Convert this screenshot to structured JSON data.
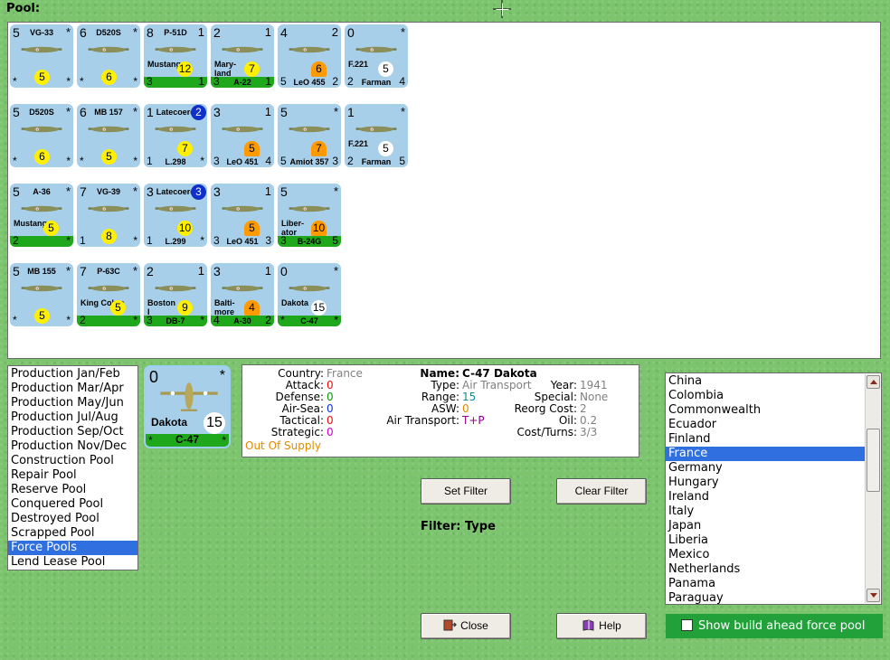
{
  "pool_label": "Pool:",
  "counters": [
    {
      "tl": "5",
      "tr": "*",
      "name": "VG-33",
      "sub": "",
      "bl": "*",
      "br": "*",
      "bname": "",
      "badge": "5",
      "badge_color": "yellow",
      "green": false
    },
    {
      "tl": "6",
      "tr": "*",
      "name": "D520S",
      "sub": "",
      "bl": "*",
      "br": "*",
      "bname": "",
      "badge": "6",
      "badge_color": "yellow",
      "green": false
    },
    {
      "tl": "8",
      "tr": "1",
      "name": "P-51D",
      "sub": "Mustang",
      "bl": "3",
      "br": "1",
      "bname": "",
      "badge": "12",
      "badge_color": "yellow",
      "green": true
    },
    {
      "tl": "2",
      "tr": "1",
      "name": "",
      "sub": "Mary-\nland",
      "bl": "3",
      "br": "1",
      "bname": "A-22",
      "badge": "7",
      "badge_color": "yellow",
      "green": true
    },
    {
      "tl": "4",
      "tr": "2",
      "name": "",
      "sub": "",
      "bl": "5",
      "br": "2",
      "bname": "LeO 455",
      "badge": "6",
      "badge_color": "orange",
      "green": false
    },
    {
      "tl": "0",
      "tr": "*",
      "name": "",
      "sub": "F.221",
      "bl": "2",
      "br": "4",
      "bname": "Farman",
      "badge": "5",
      "badge_color": "white",
      "green": false
    },
    {
      "tl": "5",
      "tr": "*",
      "name": "D520S",
      "sub": "",
      "bl": "*",
      "br": "*",
      "bname": "",
      "badge": "6",
      "badge_color": "yellow",
      "green": false
    },
    {
      "tl": "6",
      "tr": "*",
      "name": "MB 157",
      "sub": "",
      "bl": "*",
      "br": "*",
      "bname": "",
      "badge": "5",
      "badge_color": "yellow",
      "green": false
    },
    {
      "tl": "1",
      "tr": "",
      "name": "Latecoere",
      "sub": "",
      "bl": "1",
      "br": "*",
      "bname": "L.298",
      "badge": "7",
      "badge_color": "yellow",
      "badge2": "2",
      "green": false
    },
    {
      "tl": "3",
      "tr": "1",
      "name": "",
      "sub": "",
      "bl": "3",
      "br": "4",
      "bname": "LeO 451",
      "badge": "5",
      "badge_color": "orange",
      "green": false
    },
    {
      "tl": "5",
      "tr": "*",
      "name": "",
      "sub": "",
      "bl": "5",
      "br": "3",
      "bname": "Amiot 357",
      "badge": "7",
      "badge_color": "orange",
      "green": false
    },
    {
      "tl": "1",
      "tr": "*",
      "name": "",
      "sub": "F.221",
      "bl": "2",
      "br": "5",
      "bname": "Farman",
      "badge": "5",
      "badge_color": "white",
      "green": false
    },
    {
      "tl": "5",
      "tr": "*",
      "name": "A-36",
      "sub": "Mustang",
      "bl": "2",
      "br": "*",
      "bname": "",
      "badge": "5",
      "badge_color": "yellow",
      "green": true
    },
    {
      "tl": "7",
      "tr": "*",
      "name": "VG-39",
      "sub": "",
      "bl": "1",
      "br": "*",
      "bname": "",
      "badge": "8",
      "badge_color": "yellow",
      "green": false
    },
    {
      "tl": "3",
      "tr": "",
      "name": "Latecoere",
      "sub": "",
      "bl": "1",
      "br": "*",
      "bname": "L.299",
      "badge": "10",
      "badge_color": "yellow",
      "badge2": "3",
      "green": false
    },
    {
      "tl": "3",
      "tr": "1",
      "name": "",
      "sub": "",
      "bl": "3",
      "br": "3",
      "bname": "LeO 451",
      "badge": "5",
      "badge_color": "orange",
      "green": false
    },
    {
      "tl": "5",
      "tr": "*",
      "name": "",
      "sub": "Liber-\nator",
      "bl": "3",
      "br": "5",
      "bname": "B-24G",
      "badge": "10",
      "badge_color": "orange",
      "green": true
    },
    {
      "tl": "5",
      "tr": "*",
      "name": "MB 155",
      "sub": "",
      "bl": "*",
      "br": "*",
      "bname": "",
      "badge": "5",
      "badge_color": "yellow",
      "green": false
    },
    {
      "tl": "7",
      "tr": "*",
      "name": "P-63C",
      "sub": "King Cobra",
      "bl": "2",
      "br": "*",
      "bname": "",
      "badge": "5",
      "badge_color": "yellow",
      "green": true
    },
    {
      "tl": "2",
      "tr": "1",
      "name": "",
      "sub": "Boston\nI",
      "bl": "3",
      "br": "*",
      "bname": "DB-7",
      "badge": "9",
      "badge_color": "yellow",
      "green": true
    },
    {
      "tl": "3",
      "tr": "1",
      "name": "",
      "sub": "Balti-\nmore",
      "bl": "4",
      "br": "2",
      "bname": "A-30",
      "badge": "4",
      "badge_color": "orange",
      "green": true
    },
    {
      "tl": "0",
      "tr": "*",
      "name": "",
      "sub": "Dakota",
      "bl": "*",
      "br": "*",
      "bname": "C-47",
      "badge": "15",
      "badge_color": "white",
      "green": true
    }
  ],
  "selected": {
    "tl": "0",
    "tr": "*",
    "sub": "Dakota",
    "bl": "*",
    "br": "*",
    "bname": "C-47",
    "badge": "15"
  },
  "pool_list": {
    "items": [
      "Production Jan/Feb",
      "Production Mar/Apr",
      "Production May/Jun",
      "Production Jul/Aug",
      "Production Sep/Oct",
      "Production Nov/Dec",
      "Construction Pool",
      "Repair Pool",
      "Reserve Pool",
      "Conquered Pool",
      "Destroyed Pool",
      "Scrapped Pool",
      "Force Pools",
      "Lend Lease Pool"
    ],
    "selected": "Force Pools"
  },
  "info": {
    "country_k": "Country:",
    "country_v": "France",
    "attack_k": "Attack:",
    "attack_v": "0",
    "defense_k": "Defense:",
    "defense_v": "0",
    "airsea_k": "Air-Sea:",
    "airsea_v": "0",
    "tactical_k": "Tactical:",
    "tactical_v": "0",
    "strategic_k": "Strategic:",
    "strategic_v": "0",
    "supply": "Out Of Supply",
    "name_k": "Name:",
    "name_v": "C-47 Dakota",
    "type_k": "Type:",
    "type_v": "Air Transport",
    "year_k": "Year:",
    "year_v": "1941",
    "range_k": "Range:",
    "range_v": "15",
    "special_k": "Special:",
    "special_v": "None",
    "asw_k": "ASW:",
    "asw_v": "0",
    "reorg_k": "Reorg Cost:",
    "reorg_v": "2",
    "airtrans_k": "Air Transport:",
    "airtrans_v": "T+P",
    "oil_k": "Oil:",
    "oil_v": "0.2",
    "cost_k": "Cost/Turns:",
    "cost_v": "3/3"
  },
  "buttons": {
    "set_filter": "Set Filter",
    "clear_filter": "Clear Filter",
    "close": "Close",
    "help": "Help"
  },
  "filter_label": "Filter: Type",
  "country_list": {
    "items": [
      "China",
      "Colombia",
      "Commonwealth",
      "Ecuador",
      "Finland",
      "France",
      "Germany",
      "Hungary",
      "Ireland",
      "Italy",
      "Japan",
      "Liberia",
      "Mexico",
      "Netherlands",
      "Panama",
      "Paraguay"
    ],
    "selected": "France"
  },
  "build_ahead_label": "Show build ahead force pool",
  "icons": {
    "close": "close-door-icon",
    "help": "help-book-icon",
    "cursor": "crosshair-cursor-icon"
  }
}
